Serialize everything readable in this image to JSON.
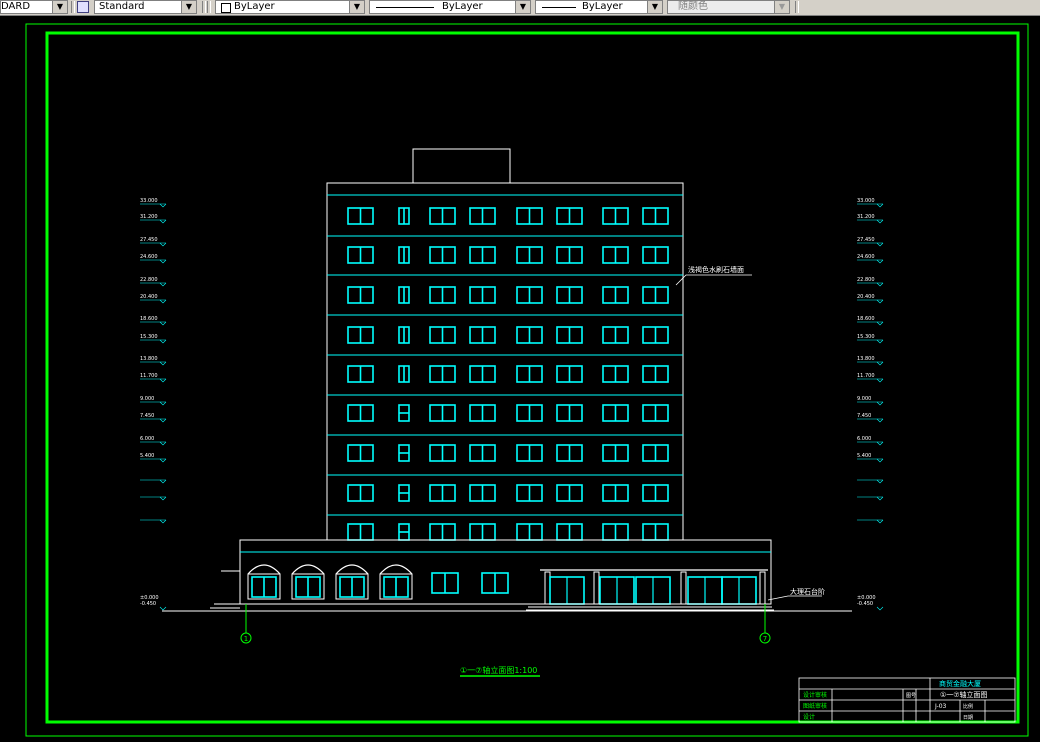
{
  "toolbar": {
    "text_style": "DARD",
    "dim_style": "Standard",
    "layer_color": "ByLayer",
    "linetype": "ByLayer",
    "lineweight": "ByLayer",
    "plot_style": "随颜色"
  },
  "drawing": {
    "title": "①一⑦轴立面图1:100",
    "note_wall": "浅褐色水刷石墙面",
    "note_platform": "大理石台阶",
    "axis_left": "1",
    "axis_right": "7",
    "elev_left_top": [
      "33.000",
      "31.200"
    ],
    "elev_left": [
      "27.450",
      "24.600",
      "22.800",
      "20.400",
      "18.600",
      "15.300",
      "13.800",
      "11.700",
      "9.000",
      "7.450",
      "6.000",
      "5.400"
    ],
    "elev_left_bottom": [
      "±0.000",
      "-0.450"
    ],
    "elev_right": [
      "33.000",
      "31.200",
      "27.450",
      "24.600",
      "22.800",
      "20.400",
      "18.600",
      "15.300",
      "13.800",
      "11.700",
      "9.000",
      "7.450",
      "6.000",
      "5.400"
    ],
    "elev_right_bottom": [
      "±0.000",
      "-0.450"
    ]
  },
  "title_block": {
    "project": "商贸金融大厦",
    "drawing_name": "①一⑦轴立面图",
    "row1": "设计审核",
    "row2": "图纸审核",
    "row3": "设计",
    "sheet_no": "J-03",
    "labels": [
      "图号",
      "比例",
      "日期"
    ]
  },
  "colors": {
    "frame": "#00ff00",
    "building": "#ffffff",
    "windows": "#00ffff",
    "background": "#000000"
  }
}
